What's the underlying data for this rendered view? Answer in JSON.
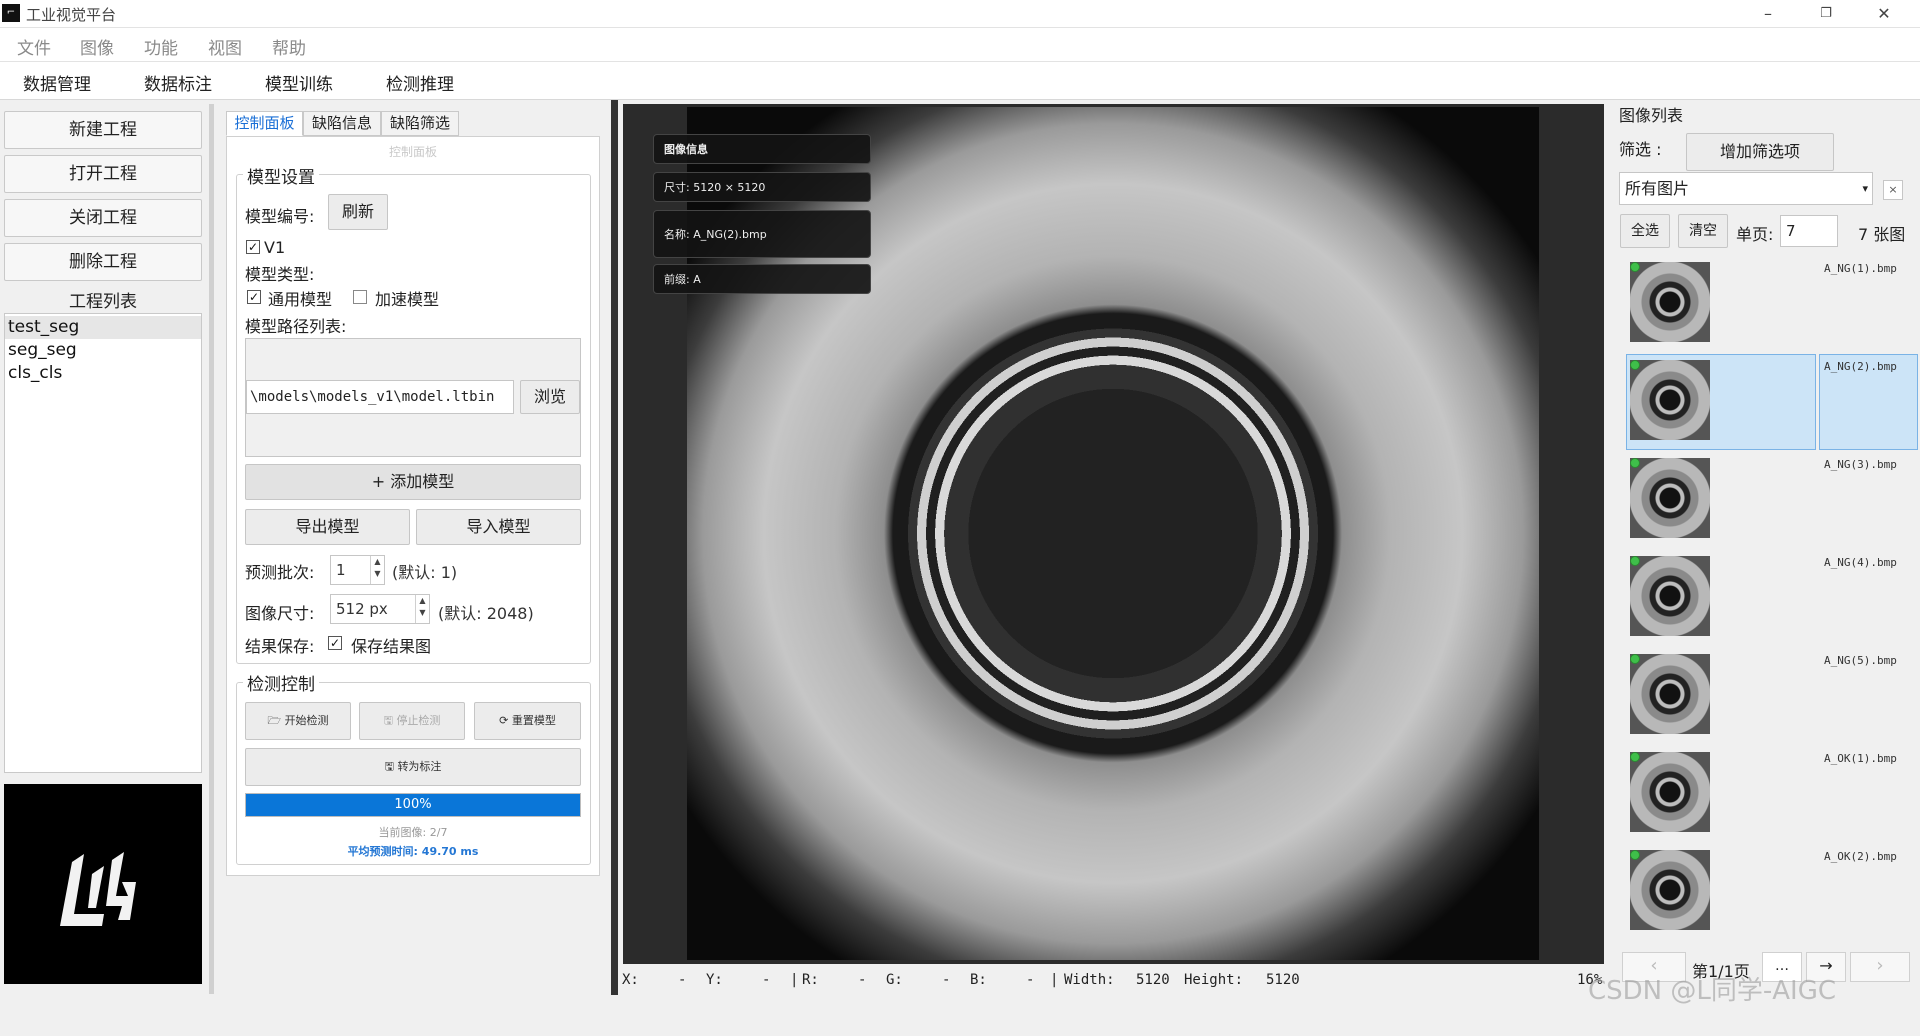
{
  "window": {
    "title": "工业视觉平台",
    "controls": {
      "minimize": "–",
      "restore": "❐",
      "close": "✕"
    }
  },
  "menu": [
    "文件",
    "图像",
    "功能",
    "视图",
    "帮助"
  ],
  "modules": [
    "数据管理",
    "数据标注",
    "模型训练",
    "检测推理"
  ],
  "project": {
    "buttons": [
      "新建工程",
      "打开工程",
      "关闭工程",
      "删除工程"
    ],
    "list_title": "工程列表",
    "list": [
      "test_seg",
      "seg_seg",
      "cls_cls"
    ],
    "selected_index": 0
  },
  "control": {
    "tabs": [
      "控制面板",
      "缺陷信息",
      "缺陷筛选"
    ],
    "active_tab": 0,
    "pane_title": "控制面板",
    "model_group": {
      "title": "模型设置",
      "model_id_label": "模型编号:",
      "refresh_label": "刷新",
      "version_label": "V1",
      "version_checked": true,
      "model_type_label": "模型类型:",
      "general_label": "通用模型",
      "general_checked": true,
      "accel_label": "加速模型",
      "accel_checked": false,
      "path_list_label": "模型路径列表:",
      "path_value": "\\models\\models_v1\\model.ltbin",
      "browse_label": "浏览",
      "add_model_label": "+ 添加模型",
      "export_label": "导出模型",
      "import_label": "导入模型",
      "batch_label": "预测批次:",
      "batch_value": "1",
      "batch_default": "(默认: 1)",
      "size_label": "图像尺寸:",
      "size_value": "512 px",
      "size_default": "(默认: 2048)",
      "save_label": "结果保存:",
      "save_result_label": "保存结果图",
      "save_checked": true
    },
    "detect_group": {
      "title": "检测控制",
      "start_label": "开始检测",
      "stop_label": "停止检测",
      "reset_label": "重置模型",
      "to_annot_label": "转为标注",
      "progress_pct": 100,
      "progress_text": "100%",
      "current_image": "当前图像: 2/7",
      "avg_time": "平均预测时间: 49.70 ms"
    }
  },
  "viewer": {
    "info_title": "图像信息",
    "size_text": "尺寸: 5120 × 5120",
    "name_text": "名称: A_NG(2).bmp",
    "prefix_text": "前缀: A"
  },
  "status": {
    "x_label": "X:",
    "x_value": "-",
    "y_label": "Y:",
    "y_value": "-",
    "r_label": "R:",
    "r_value": "-",
    "g_label": "G:",
    "g_value": "-",
    "b_label": "B:",
    "b_value": "-",
    "width_label": "Width:",
    "width_value": "5120",
    "height_label": "Height:",
    "height_value": "5120",
    "zoom": "16%"
  },
  "image_list": {
    "title": "图像列表",
    "filter_label": "筛选 :",
    "add_filter_label": "增加筛选项",
    "filter_value": "所有图片",
    "filter_clear": "×",
    "select_all_label": "全选",
    "clear_label": "清空",
    "page_size_label": "单页:",
    "page_size_value": "7",
    "count_text": "7 张图",
    "items": [
      "A_NG(1).bmp",
      "A_NG(2).bmp",
      "A_NG(3).bmp",
      "A_NG(4).bmp",
      "A_NG(5).bmp",
      "A_OK(1).bmp",
      "A_OK(2).bmp"
    ],
    "selected_index": 1,
    "page_text": "第1/1页",
    "prev_label": "‹",
    "first_label": "«",
    "goto_label": "…",
    "next_label": "→",
    "last_label": "›"
  },
  "watermark": "CSDN @L同学-AIGC"
}
